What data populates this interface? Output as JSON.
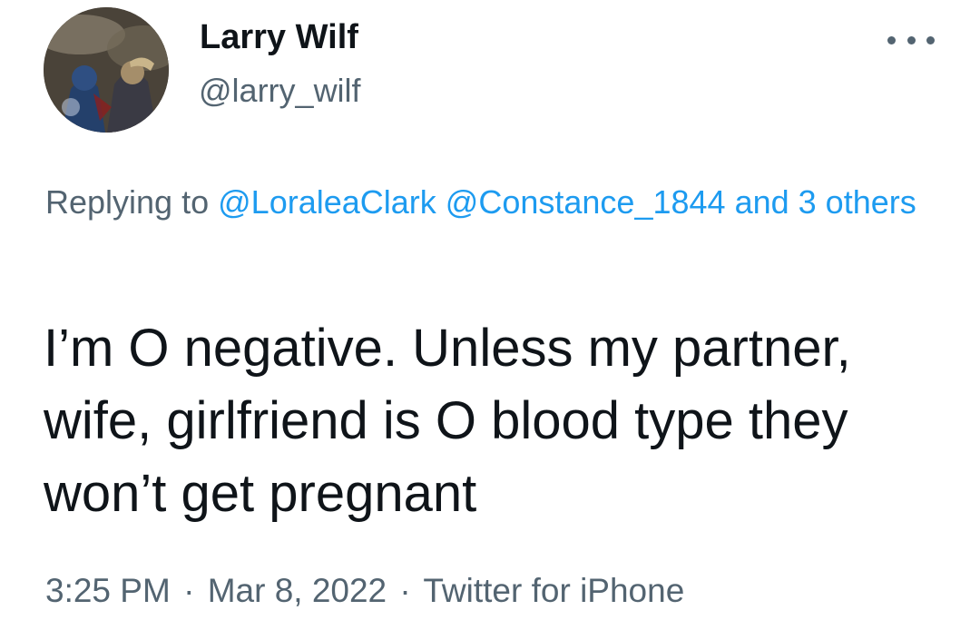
{
  "author": {
    "name": "Larry Wilf",
    "handle": "@larry_wilf"
  },
  "more_icon": "more-horizontal-icon",
  "reply": {
    "prefix": "Replying to",
    "mention_1": "@LoraleaClark",
    "mention_2": "@Constance_1844",
    "others": "and 3 others"
  },
  "tweet": {
    "text": "I’m O negative. Unless my partner, wife, girlfriend is O blood type they won’t get pregnant"
  },
  "meta": {
    "time": "3:25 PM",
    "separator": "·",
    "date": "Mar 8, 2022",
    "source": "Twitter for iPhone"
  },
  "colors": {
    "text": "#0f1419",
    "secondary": "#536471",
    "link": "#1d9bf0"
  }
}
